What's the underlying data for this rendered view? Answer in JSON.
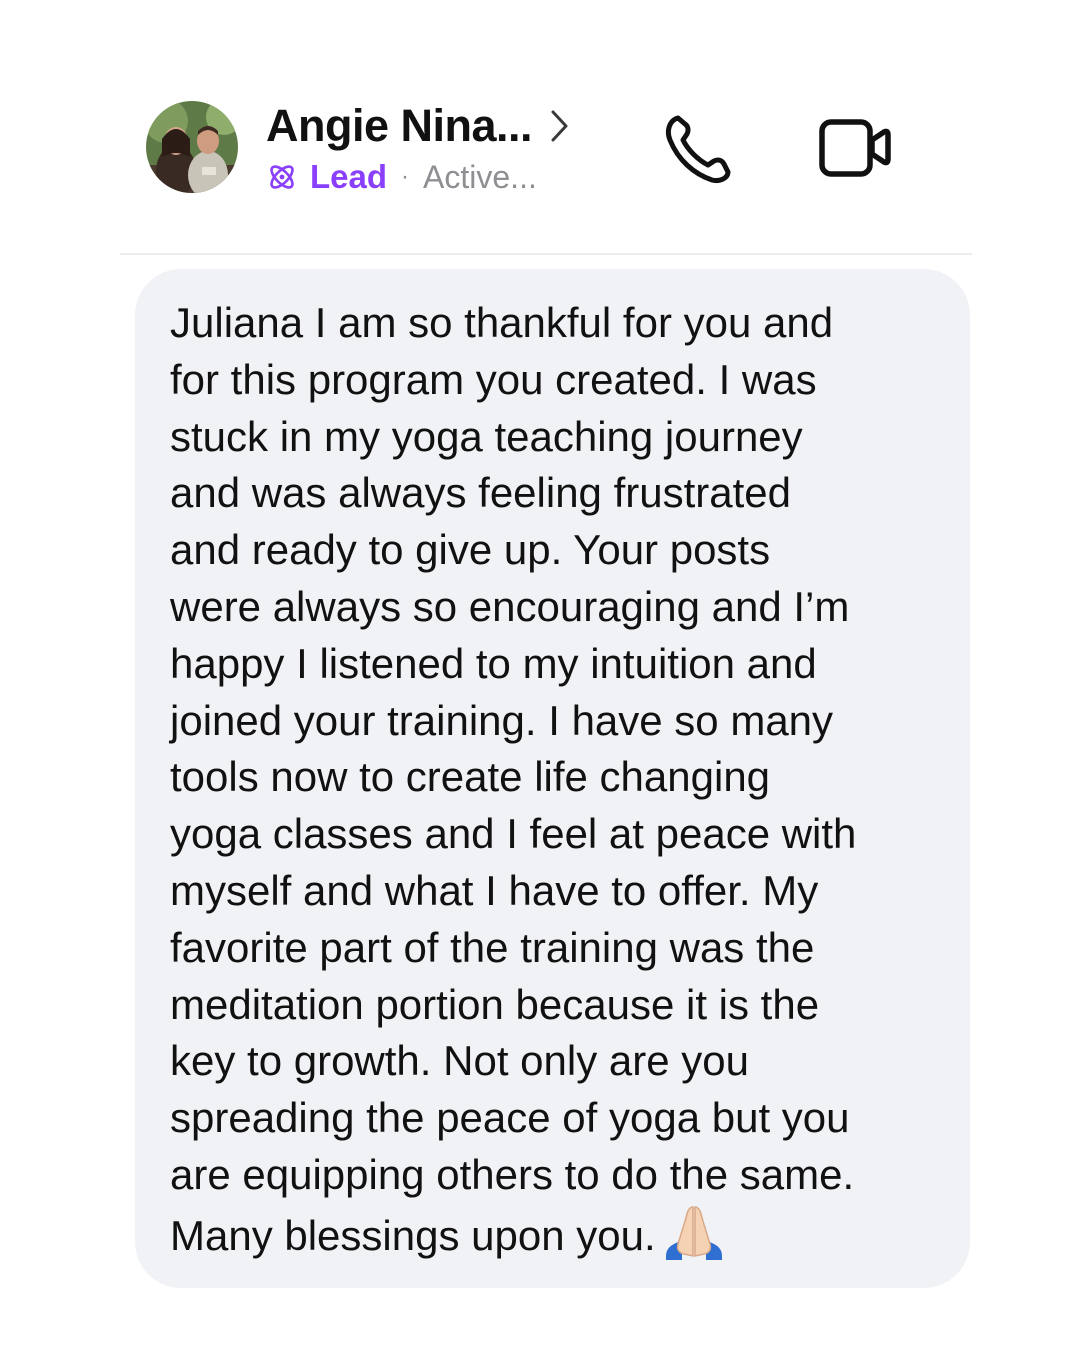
{
  "header": {
    "contact_name": "Angie Nina...",
    "tag_label": "Lead",
    "separator": "·",
    "status": "Active...",
    "icons": {
      "avatar": "avatar-photo",
      "chevron": "chevron-right-icon",
      "lead": "lead-atom-icon",
      "call": "phone-icon",
      "video": "video-camera-icon"
    }
  },
  "message": {
    "text": "Juliana I am so thankful for you and\nfor this program you created. I was\nstuck in my yoga teaching journey\nand was always feeling frustrated\nand ready to give up. Your posts\nwere always so encouraging and I’m\nhappy I listened to my intuition and\njoined your training. I have so many\ntools now to create life changing\nyoga classes and I feel at peace with\nmyself and what I have to offer. My\nfavorite part of the training was the\nmeditation portion because it is the\nkey to growth. Not only are you\nspreading the peace of yoga but you\nare equipping others to do the same.\nMany blessings upon you.",
    "emoji": "folded-hands-emoji"
  },
  "colors": {
    "accent": "#8a3ffc",
    "secondary_text": "#8e8e93",
    "bubble": "#f1f2f5"
  }
}
